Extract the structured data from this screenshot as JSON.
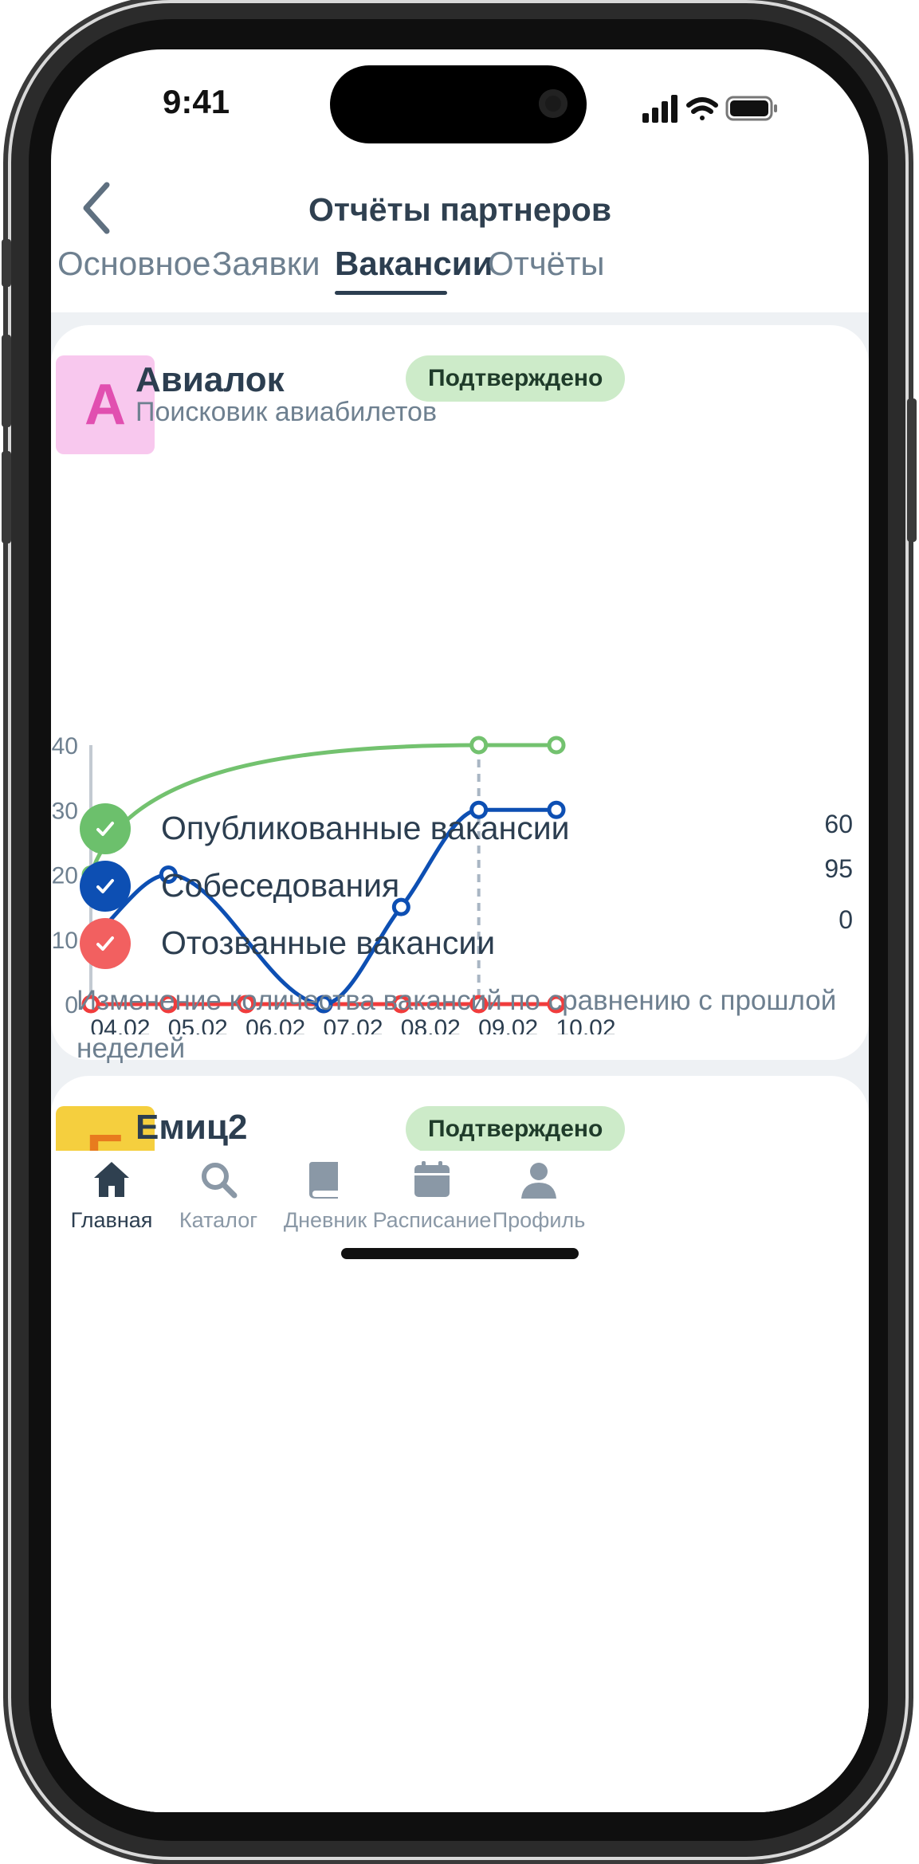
{
  "status_bar": {
    "time": "9:41"
  },
  "header": {
    "title": "Отчёты партнеров"
  },
  "tabs": [
    {
      "label": "Основное",
      "active": false
    },
    {
      "label": "Заявки",
      "active": false
    },
    {
      "label": "Вакансии",
      "active": true
    },
    {
      "label": "Отчёты",
      "active": false
    }
  ],
  "card": {
    "logo_letter": "A",
    "logo_bg": "#f8c8ee",
    "logo_fg": "#e14fb0",
    "name": "Авиалок",
    "subtitle": "Поисковик авиабилетов",
    "status": "Подтверждено",
    "legend": [
      {
        "label": "Опубликованные вакансии",
        "value": "60",
        "color": "#6cc06c"
      },
      {
        "label": "Собеседования",
        "value": "95",
        "color": "#0d4fb3"
      },
      {
        "label": "Отозванные вакансии",
        "value": "0",
        "color": "#f26060"
      }
    ],
    "note": "Изменение количества вакансий по сравнению с прошлой неделей"
  },
  "card2": {
    "logo_letter": "E",
    "logo_bg": "#f5cf3e",
    "logo_fg": "#e87b1e",
    "name": "Емиц2",
    "status": "Подтверждено"
  },
  "chart_data": {
    "type": "line",
    "categories": [
      "04.02",
      "05.02",
      "06.02",
      "07.02",
      "08.02",
      "09.02",
      "10.02"
    ],
    "ylim": [
      0,
      40
    ],
    "yticks": [
      "40",
      "30",
      "20",
      "10",
      "0"
    ],
    "series": [
      {
        "name": "Опубликованные вакансии",
        "color": "#73c26f",
        "x": [
          0,
          5.0,
          6.0
        ],
        "y": [
          20,
          40,
          40
        ]
      },
      {
        "name": "Собеседования",
        "color": "#0d4fb3",
        "x": [
          0,
          1,
          3,
          4,
          5.0,
          6.0
        ],
        "y": [
          10,
          20,
          0,
          15,
          30,
          30
        ]
      },
      {
        "name": "Отозванные вакансии",
        "color": "#f03c3c",
        "x": [
          0,
          1,
          2,
          3,
          4,
          5.0,
          6.0
        ],
        "y": [
          0,
          0,
          0,
          0,
          0,
          0,
          0
        ]
      }
    ],
    "highlight_x": 5.0
  },
  "bottom_nav": [
    {
      "label": "Главная",
      "icon": "home-icon",
      "active": true
    },
    {
      "label": "Каталог",
      "icon": "search-icon",
      "active": false
    },
    {
      "label": "Дневник",
      "icon": "book-icon",
      "active": false
    },
    {
      "label": "Расписание",
      "icon": "calendar-icon",
      "active": false
    },
    {
      "label": "Профиль",
      "icon": "user-icon",
      "active": false
    }
  ]
}
